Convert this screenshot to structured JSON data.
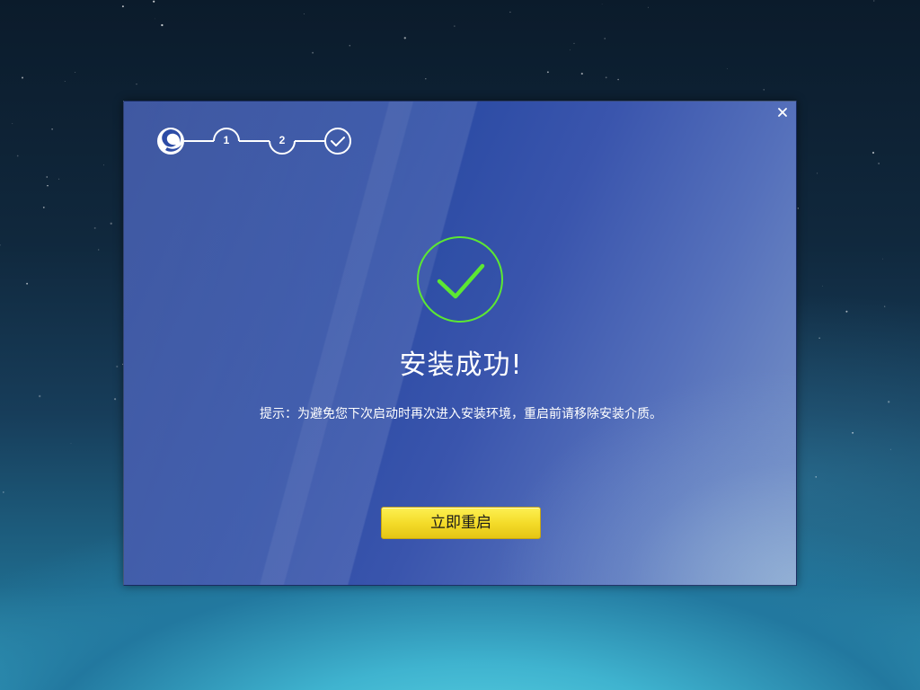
{
  "dialog": {
    "title": "安装成功!",
    "hint": "提示：为避免您下次启动时再次进入安装环境，重启前请移除安装介质。",
    "close_icon": "close-icon",
    "close_symbol": "×"
  },
  "stepper": {
    "logo_icon": "logo-icon",
    "steps": [
      "1",
      "2"
    ],
    "final_icon": "check-icon"
  },
  "success": {
    "icon": "check-circle-icon",
    "color": "#5ce832"
  },
  "actions": {
    "restart_label": "立即重启",
    "restart_color": "#f4dc2a"
  }
}
